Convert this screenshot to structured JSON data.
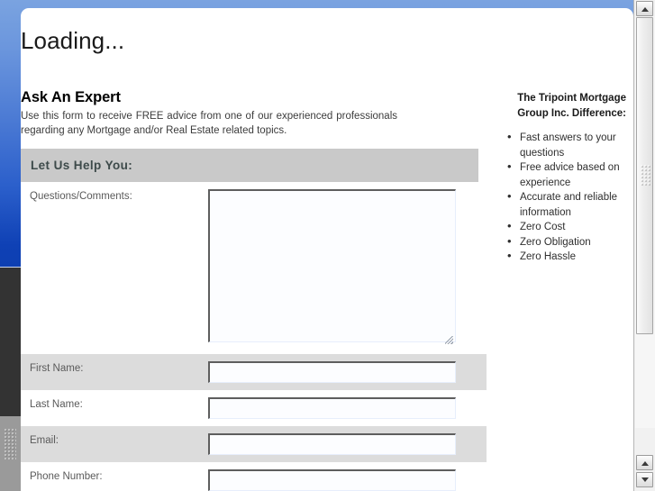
{
  "window": {
    "status_title": "Loading..."
  },
  "main": {
    "heading": "Ask An Expert",
    "intro": "Use this form to receive FREE advice from one of our experienced professionals regarding any Mortgage and/or Real Estate related topics.",
    "section_header": "Let Us Help You:"
  },
  "form": {
    "fields": [
      {
        "label": "Questions/Comments:",
        "value": "",
        "placeholder": "",
        "type": "textarea",
        "shaded": false
      },
      {
        "label": "First Name:",
        "value": "",
        "placeholder": "",
        "type": "text",
        "shaded": true
      },
      {
        "label": "Last Name:",
        "value": "",
        "placeholder": "",
        "type": "text",
        "shaded": false
      },
      {
        "label": "Email:",
        "value": "",
        "placeholder": "",
        "type": "text",
        "shaded": true
      },
      {
        "label": "Phone Number:",
        "value": "",
        "placeholder": "",
        "type": "text",
        "shaded": false
      }
    ]
  },
  "aside": {
    "title": "The Tripoint Mortgage Group Inc. Difference:",
    "bullets": [
      "Fast answers to your questions",
      "Free advice based on experience",
      "Accurate and reliable information",
      "Zero Cost",
      "Zero Obligation",
      "Zero Hassle"
    ]
  },
  "scrollbars": {
    "up_arrow_icon": "triangle-up-icon",
    "down_arrow_icon": "triangle-down-icon"
  },
  "colors": {
    "page_gradient_top": "#7aa3e0",
    "page_gradient_bottom": "#0d3fb2",
    "section_header_bg": "#c9c9c9",
    "section_header_text": "#3d4a4a",
    "row_shaded_bg": "#dcdcdc",
    "card_bg": "#ffffff",
    "label_text": "#5a5a5a"
  }
}
